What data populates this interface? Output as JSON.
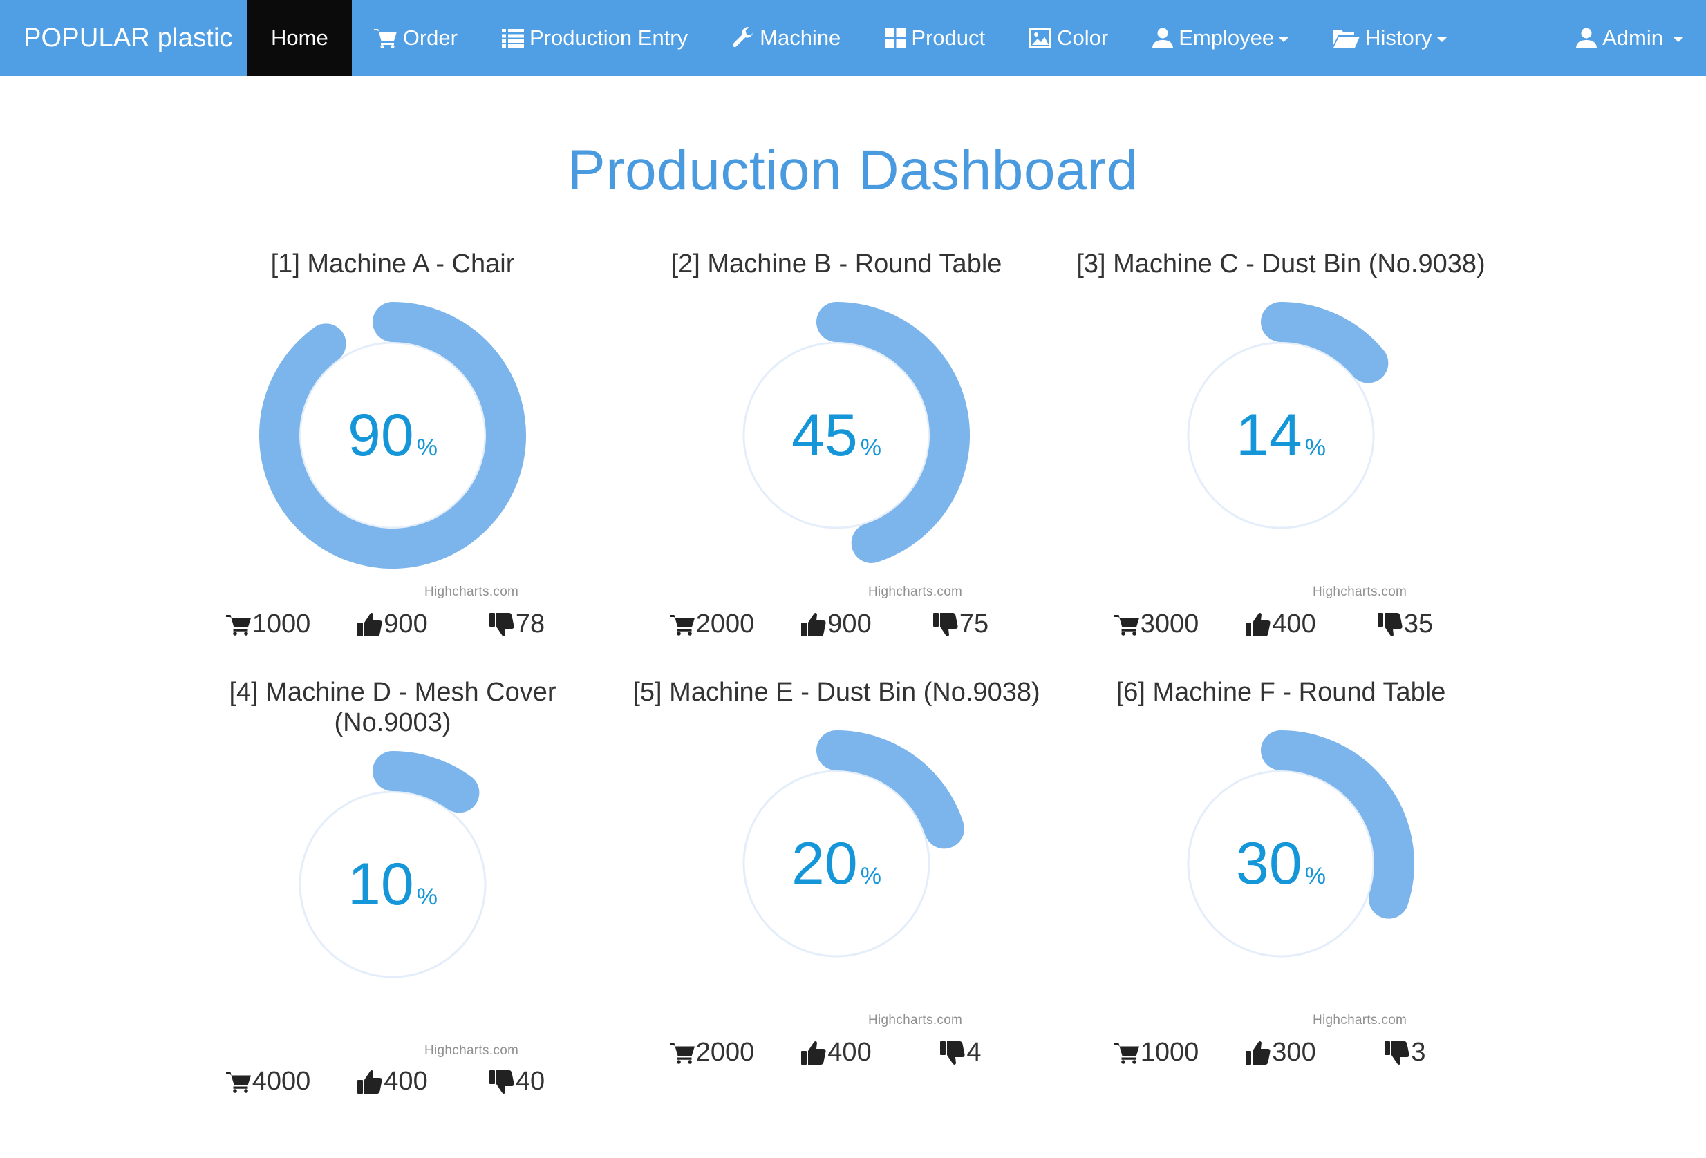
{
  "navbar": {
    "brand": "POPULAR plastic",
    "items": [
      {
        "label": "Home",
        "icon": "none",
        "active": true
      },
      {
        "label": "Order",
        "icon": "shopping-cart-icon"
      },
      {
        "label": "Production Entry",
        "icon": "list-icon"
      },
      {
        "label": "Machine",
        "icon": "wrench-icon"
      },
      {
        "label": "Product",
        "icon": "grid-icon"
      },
      {
        "label": "Color",
        "icon": "picture-icon"
      },
      {
        "label": "Employee",
        "icon": "user-icon",
        "dropdown": true
      },
      {
        "label": "History",
        "icon": "folder-open-icon",
        "dropdown": true
      }
    ],
    "user": {
      "label": "Admin",
      "icon": "user-icon",
      "dropdown": true
    },
    "colors": {
      "background": "#509fe4",
      "active": "#0b0b0b",
      "text": "#ffffff"
    }
  },
  "page": {
    "title": "Production Dashboard",
    "title_color": "#4a9ae0"
  },
  "machines": [
    {
      "title": "[1] Machine A - Chair",
      "percent": 90,
      "percent_text": "90",
      "unit": "%",
      "credit": "Highcharts.com",
      "order": "1000",
      "good": "900",
      "bad": "78"
    },
    {
      "title": "[2] Machine B - Round Table",
      "percent": 45,
      "percent_text": "45",
      "unit": "%",
      "credit": "Highcharts.com",
      "order": "2000",
      "good": "900",
      "bad": "75"
    },
    {
      "title": "[3] Machine C - Dust Bin (No.9038)",
      "percent": 14,
      "percent_text": "14",
      "unit": "%",
      "credit": "Highcharts.com",
      "order": "3000",
      "good": "400",
      "bad": "35"
    },
    {
      "title": "[4] Machine D - Mesh Cover (No.9003)",
      "percent": 10,
      "percent_text": "10",
      "unit": "%",
      "credit": "Highcharts.com",
      "order": "4000",
      "good": "400",
      "bad": "40"
    },
    {
      "title": "[5] Machine E - Dust Bin (No.9038)",
      "percent": 20,
      "percent_text": "20",
      "unit": "%",
      "credit": "Highcharts.com",
      "order": "2000",
      "good": "400",
      "bad": "4"
    },
    {
      "title": "[6] Machine F - Round Table",
      "percent": 30,
      "percent_text": "30",
      "unit": "%",
      "credit": "Highcharts.com",
      "order": "1000",
      "good": "300",
      "bad": "3"
    }
  ],
  "gauge_colors": {
    "arc": "#7cb4ec",
    "track": "#e4eefa",
    "value_text": "#1596d8"
  }
}
